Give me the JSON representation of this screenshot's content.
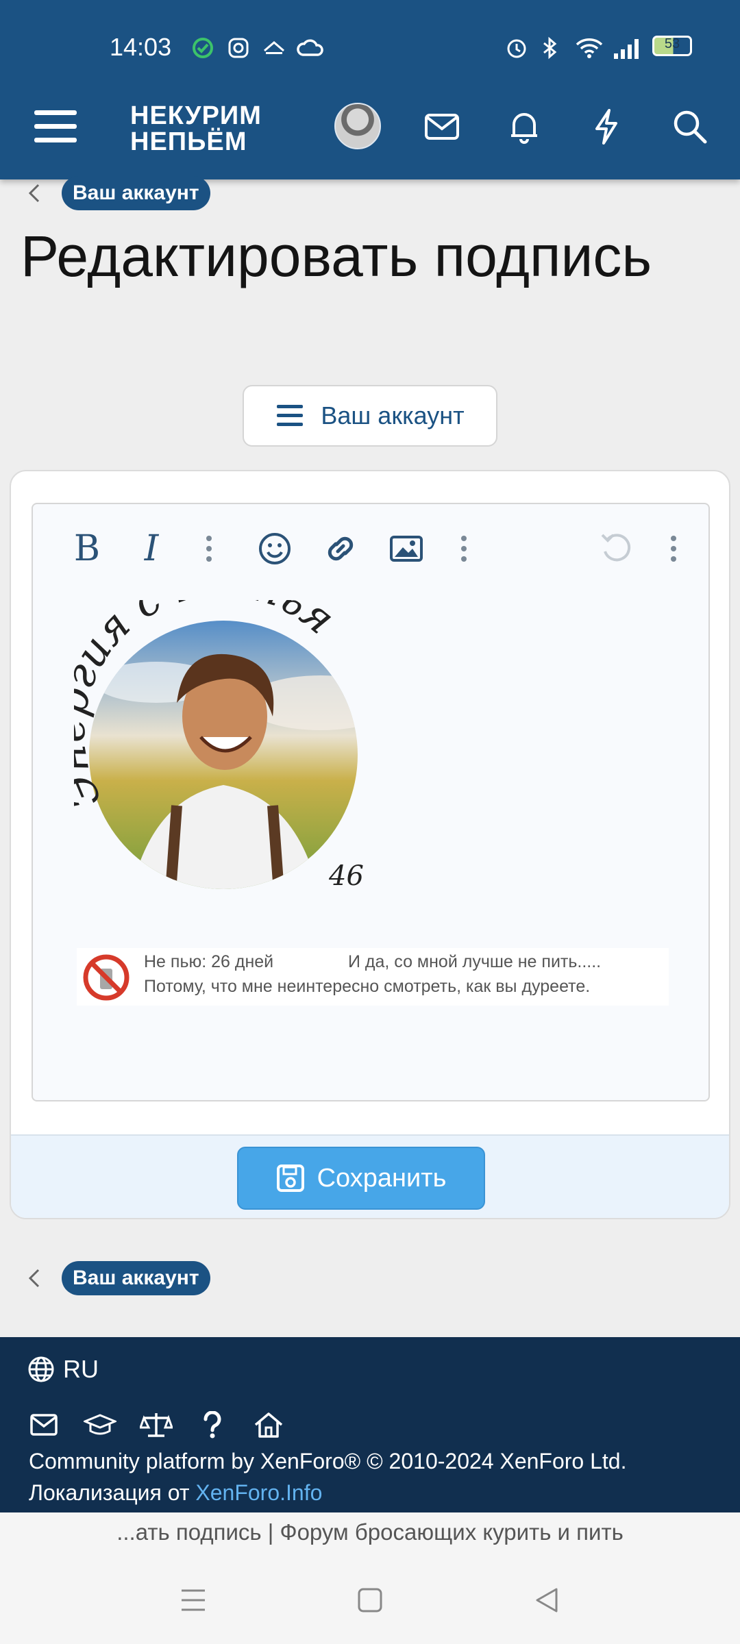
{
  "status_bar": {
    "time": "14:03",
    "battery": "53"
  },
  "header": {
    "logo_line1": "НЕКУРИМ",
    "logo_line2": "НЕПЬЁМ"
  },
  "breadcrumb": {
    "label": "Ваш аккаунт"
  },
  "page": {
    "title": "Редактировать подпись"
  },
  "account_menu_button": {
    "label": "Ваш аккаунт"
  },
  "editor": {
    "toolbar_icons": [
      "bold-icon",
      "italic-icon",
      "more-icon",
      "smile-icon",
      "link-icon",
      "image-icon",
      "more-icon",
      "undo-icon",
      "more-icon"
    ],
    "signature": {
      "image_text": "Энергия счастья",
      "image_number": "46",
      "bar_left_line1": "Не пью: 26 дней",
      "bar_right_line1": "И да, со мной лучше не пить.....",
      "bar_line2": "Потому, что мне неинтересно смотреть, как вы дуреете."
    }
  },
  "form": {
    "save_label": "Сохранить"
  },
  "footer_breadcrumb": {
    "label": "Ваш аккаунт"
  },
  "footer": {
    "language": "RU",
    "copyright_line1": "Community platform by XenForo® © 2010-2024 XenForo Ltd.",
    "localization_prefix": "Локализация от ",
    "localization_link": "XenForo.Info"
  },
  "browser": {
    "tab_title": "...ать подпись | Форум бросающих курить и пить"
  },
  "colors": {
    "header_bg": "#1b5283",
    "accent": "#47a6e8",
    "footer_bg": "#112f4f"
  }
}
